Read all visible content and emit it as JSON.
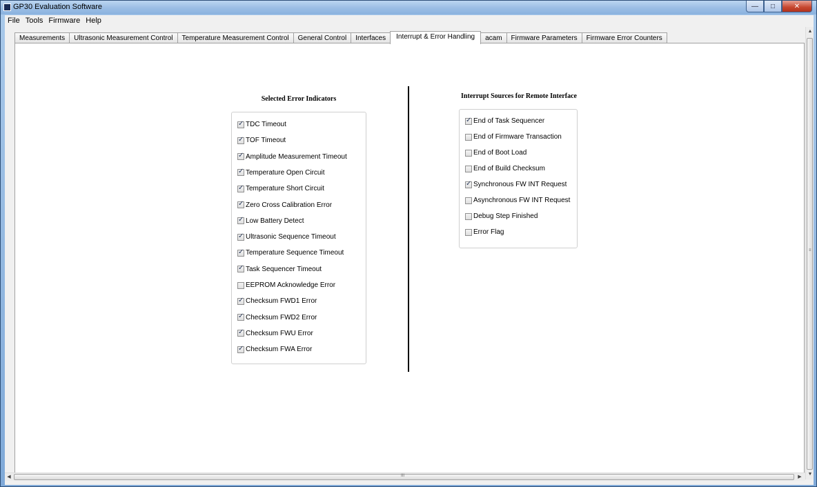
{
  "window": {
    "title": "GP30 Evaluation Software"
  },
  "menu": [
    "File",
    "Tools",
    "Firmware",
    "Help"
  ],
  "tabs": [
    "Measurements",
    "Ultrasonic Measurement Control",
    "Temperature Measurement Control",
    "General Control",
    "Interfaces",
    "Interrupt & Error Handling",
    "acam",
    "Firmware Parameters",
    "Firmware Error Counters"
  ],
  "active_tab": "Interrupt & Error Handling",
  "error_panel": {
    "title": "Selected Error Indicators",
    "items": [
      {
        "label": "TDC Timeout",
        "checked": true
      },
      {
        "label": "TOF Timeout",
        "checked": true
      },
      {
        "label": "Amplitude Measurement Timeout",
        "checked": true
      },
      {
        "label": "Temperature Open Circuit",
        "checked": true
      },
      {
        "label": "Temperature Short Circuit",
        "checked": true
      },
      {
        "label": "Zero Cross Calibration Error",
        "checked": true
      },
      {
        "label": "Low Battery Detect",
        "checked": true
      },
      {
        "label": "Ultrasonic Sequence Timeout",
        "checked": true
      },
      {
        "label": "Temperature Sequence Timeout",
        "checked": true
      },
      {
        "label": "Task Sequencer Timeout",
        "checked": true
      },
      {
        "label": "EEPROM Acknowledge Error",
        "checked": false
      },
      {
        "label": "Checksum FWD1 Error",
        "checked": true
      },
      {
        "label": "Checksum FWD2 Error",
        "checked": true
      },
      {
        "label": "Checksum FWU Error",
        "checked": true
      },
      {
        "label": "Checksum FWA Error",
        "checked": true
      }
    ]
  },
  "interrupt_panel": {
    "title": "Interrupt Sources for Remote Interface",
    "items": [
      {
        "label": "End of Task Sequencer",
        "checked": true
      },
      {
        "label": "End of Firmware Transaction",
        "checked": false
      },
      {
        "label": "End of Boot Load",
        "checked": false
      },
      {
        "label": "End of Build Checksum",
        "checked": false
      },
      {
        "label": "Synchronous FW INT Request",
        "checked": true
      },
      {
        "label": "Asynchronous FW INT Request",
        "checked": false
      },
      {
        "label": "Debug Step Finished",
        "checked": false
      },
      {
        "label": "Error Flag",
        "checked": false
      }
    ]
  },
  "scrollbar": {
    "vertical_grip": "≡",
    "horizontal_grip": "III"
  }
}
